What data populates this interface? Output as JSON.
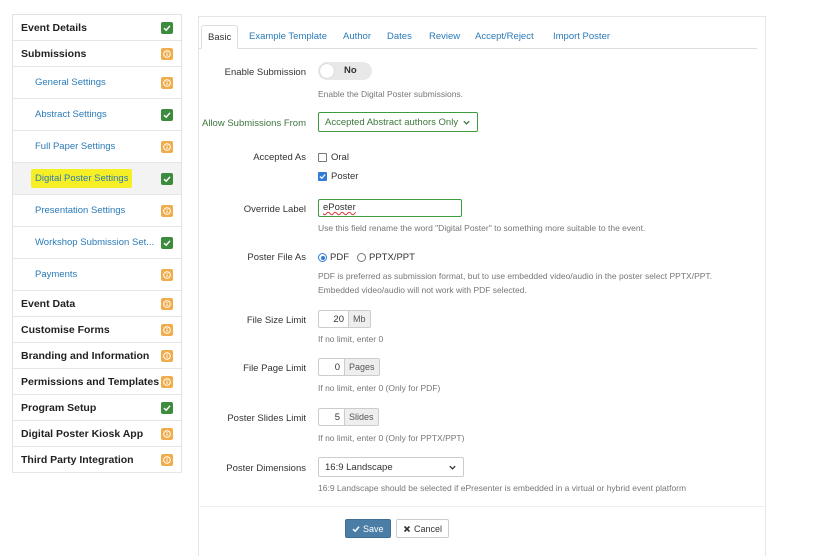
{
  "sidebar": {
    "items": [
      {
        "label": "Event Details",
        "badge": "green"
      },
      {
        "label": "Submissions",
        "badge": "orange"
      },
      {
        "label": "General Settings",
        "badge": "orange"
      },
      {
        "label": "Abstract Settings",
        "badge": "green"
      },
      {
        "label": "Full Paper Settings",
        "badge": "orange"
      },
      {
        "label": "Digital Poster Settings",
        "badge": "green"
      },
      {
        "label": "Presentation Settings",
        "badge": "orange"
      },
      {
        "label": "Workshop Submission Set...",
        "badge": "green"
      },
      {
        "label": "Payments",
        "badge": "orange"
      },
      {
        "label": "Event Data",
        "badge": "orange"
      },
      {
        "label": "Customise Forms",
        "badge": "orange"
      },
      {
        "label": "Branding and Information",
        "badge": "orange"
      },
      {
        "label": "Permissions and Templates",
        "badge": "orange"
      },
      {
        "label": "Program Setup",
        "badge": "green"
      },
      {
        "label": "Digital Poster Kiosk App",
        "badge": "orange"
      },
      {
        "label": "Third Party Integration",
        "badge": "orange"
      }
    ]
  },
  "tabs": [
    "Basic",
    "Example Template",
    "Author",
    "Dates",
    "Review",
    "Accept/Reject",
    "Import Poster"
  ],
  "form": {
    "enable_submission": {
      "label": "Enable Submission",
      "value": "No",
      "help": "Enable the Digital Poster submissions."
    },
    "allow_from": {
      "label": "Allow Submissions From",
      "value": "Accepted Abstract authors Only"
    },
    "accepted_as": {
      "label": "Accepted As",
      "opt1": "Oral",
      "opt2": "Poster"
    },
    "override_label": {
      "label": "Override Label",
      "value": "ePoster",
      "help": "Use this field rename the word \"Digital Poster\" to something more suitable to the event."
    },
    "poster_file_as": {
      "label": "Poster File As",
      "opt1": "PDF",
      "opt2": "PPTX/PPT",
      "help1": "PDF is preferred as submission format, but to use embedded video/audio in the poster select PPTX/PPT.",
      "help2": "Embedded video/audio will not work with PDF selected."
    },
    "file_size": {
      "label": "File Size Limit",
      "value": "20",
      "unit": "Mb",
      "help": "If no limit, enter 0"
    },
    "file_page": {
      "label": "File Page Limit",
      "value": "0",
      "unit": "Pages",
      "help": "If no limit, enter 0 (Only for PDF)"
    },
    "poster_slides": {
      "label": "Poster Slides Limit",
      "value": "5",
      "unit": "Slides",
      "help": "If no limit, enter 0 (Only for PPTX/PPT)"
    },
    "poster_dimensions": {
      "label": "Poster Dimensions",
      "value": "16:9 Landscape",
      "help": "16:9 Landscape should be selected if ePresenter is embedded in a virtual or hybrid event platform"
    }
  },
  "buttons": {
    "save": "Save",
    "cancel": "Cancel"
  },
  "colors": {
    "link": "#2a7ab8",
    "green_badge": "#3d8b3d",
    "orange_badge": "#f0ad4e",
    "highlight": "#f7ef26",
    "save": "#4a7ea7"
  }
}
